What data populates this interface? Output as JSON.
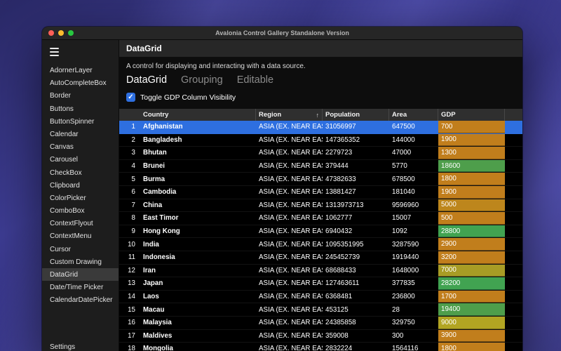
{
  "window": {
    "title": "Avalonia Control Gallery Standalone Version",
    "traffic_light_colors": [
      "#FF5F57",
      "#FEBC2E",
      "#28C840"
    ],
    "accent_color": "#2E6FE0",
    "selection_color": "#2E6FE0"
  },
  "sidebar": {
    "items": [
      "AdornerLayer",
      "AutoCompleteBox",
      "Border",
      "Buttons",
      "ButtonSpinner",
      "Calendar",
      "Canvas",
      "Carousel",
      "CheckBox",
      "Clipboard",
      "ColorPicker",
      "ComboBox",
      "ContextFlyout",
      "ContextMenu",
      "Cursor",
      "Custom Drawing",
      "DataGrid",
      "Date/Time Picker",
      "CalendarDatePicker"
    ],
    "selected": "DataGrid",
    "bottom_item": "Settings"
  },
  "page": {
    "title": "DataGrid",
    "description": "A control for displaying and interacting with a data source.",
    "tabs": [
      {
        "label": "DataGrid",
        "selected": true
      },
      {
        "label": "Grouping",
        "selected": false
      },
      {
        "label": "Editable",
        "selected": false
      }
    ],
    "checkbox_label": "Toggle GDP Column Visibility",
    "checkbox_checked": true,
    "checkbox_glyph": "✓"
  },
  "grid": {
    "columns": [
      "Country",
      "Region",
      "Population",
      "Area",
      "GDP"
    ],
    "sort_column": "Region",
    "sort_icon": "↑",
    "rows": [
      {
        "num": "1",
        "country": "Afghanistan",
        "region": "ASIA (EX. NEAR EAST)",
        "population": "31056997",
        "area": "647500",
        "gdp": "700",
        "gdp_color": "#C17E1C",
        "selected": true
      },
      {
        "num": "2",
        "country": "Bangladesh",
        "region": "ASIA (EX. NEAR EAST)",
        "population": "147365352",
        "area": "144000",
        "gdp": "1900",
        "gdp_color": "#C17E1C",
        "selected": false
      },
      {
        "num": "3",
        "country": "Bhutan",
        "region": "ASIA (EX. NEAR EAST)",
        "population": "2279723",
        "area": "47000",
        "gdp": "1300",
        "gdp_color": "#C17E1C",
        "selected": false
      },
      {
        "num": "4",
        "country": "Brunei",
        "region": "ASIA (EX. NEAR EAST)",
        "population": "379444",
        "area": "5770",
        "gdp": "18600",
        "gdp_color": "#4E9E4B",
        "selected": false
      },
      {
        "num": "5",
        "country": "Burma",
        "region": "ASIA (EX. NEAR EAST)",
        "population": "47382633",
        "area": "678500",
        "gdp": "1800",
        "gdp_color": "#C17E1C",
        "selected": false
      },
      {
        "num": "6",
        "country": "Cambodia",
        "region": "ASIA (EX. NEAR EAST)",
        "population": "13881427",
        "area": "181040",
        "gdp": "1900",
        "gdp_color": "#C17E1C",
        "selected": false
      },
      {
        "num": "7",
        "country": "China",
        "region": "ASIA (EX. NEAR EAST)",
        "population": "1313973713",
        "area": "9596960",
        "gdp": "5000",
        "gdp_color": "#BD861C",
        "selected": false
      },
      {
        "num": "8",
        "country": "East Timor",
        "region": "ASIA (EX. NEAR EAST)",
        "population": "1062777",
        "area": "15007",
        "gdp": "500",
        "gdp_color": "#C17E1C",
        "selected": false
      },
      {
        "num": "9",
        "country": "Hong Kong",
        "region": "ASIA (EX. NEAR EAST)",
        "population": "6940432",
        "area": "1092",
        "gdp": "28800",
        "gdp_color": "#41A351",
        "selected": false
      },
      {
        "num": "10",
        "country": "India",
        "region": "ASIA (EX. NEAR EAST)",
        "population": "1095351995",
        "area": "3287590",
        "gdp": "2900",
        "gdp_color": "#C17E1C",
        "selected": false
      },
      {
        "num": "11",
        "country": "Indonesia",
        "region": "ASIA (EX. NEAR EAST)",
        "population": "245452739",
        "area": "1919440",
        "gdp": "3200",
        "gdp_color": "#C17E1C",
        "selected": false
      },
      {
        "num": "12",
        "country": "Iran",
        "region": "ASIA (EX. NEAR EAST)",
        "population": "68688433",
        "area": "1648000",
        "gdp": "7000",
        "gdp_color": "#A89C25",
        "selected": false
      },
      {
        "num": "13",
        "country": "Japan",
        "region": "ASIA (EX. NEAR EAST)",
        "population": "127463611",
        "area": "377835",
        "gdp": "28200",
        "gdp_color": "#41A351",
        "selected": false
      },
      {
        "num": "14",
        "country": "Laos",
        "region": "ASIA (EX. NEAR EAST)",
        "population": "6368481",
        "area": "236800",
        "gdp": "1700",
        "gdp_color": "#C17E1C",
        "selected": false
      },
      {
        "num": "15",
        "country": "Macau",
        "region": "ASIA (EX. NEAR EAST)",
        "population": "453125",
        "area": "28",
        "gdp": "19400",
        "gdp_color": "#4E9E4B",
        "selected": false
      },
      {
        "num": "16",
        "country": "Malaysia",
        "region": "ASIA (EX. NEAR EAST)",
        "population": "24385858",
        "area": "329750",
        "gdp": "9000",
        "gdp_color": "#B2A522",
        "selected": false
      },
      {
        "num": "17",
        "country": "Maldives",
        "region": "ASIA (EX. NEAR EAST)",
        "population": "359008",
        "area": "300",
        "gdp": "3900",
        "gdp_color": "#C17E1C",
        "selected": false
      },
      {
        "num": "18",
        "country": "Mongolia",
        "region": "ASIA (EX. NEAR EAST)",
        "population": "2832224",
        "area": "1564116",
        "gdp": "1800",
        "gdp_color": "#C17E1C",
        "selected": false
      }
    ]
  }
}
